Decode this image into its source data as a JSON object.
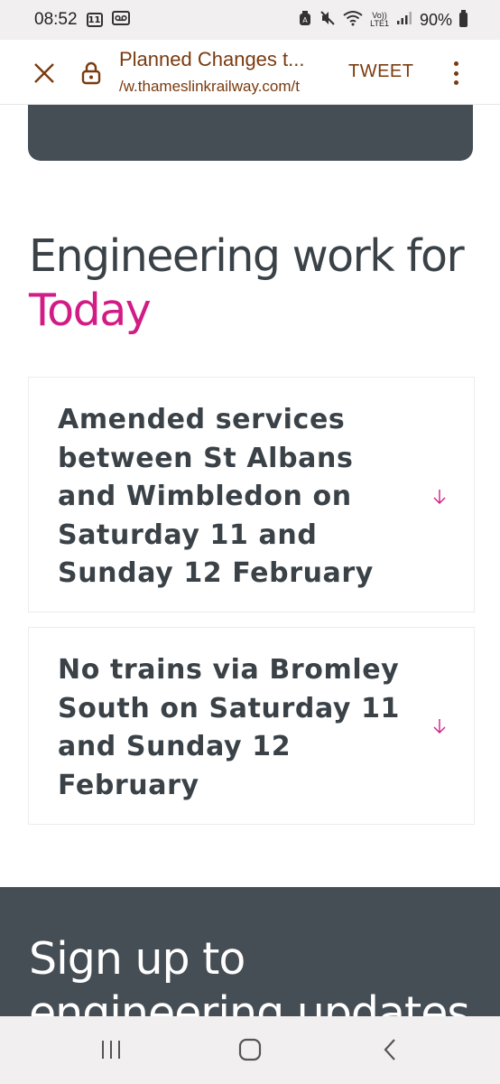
{
  "status_bar": {
    "time": "08:52",
    "notif_calendar": "11",
    "lte_top": "Vo))",
    "lte_bottom": "LTE1",
    "battery": "90%"
  },
  "toolbar": {
    "page_title": "Planned Changes t...",
    "url": "/w.thameslinkrailway.com/t",
    "tweet_label": "TWEET"
  },
  "content": {
    "heading_line1": "Engineering work for",
    "heading_accent": "Today",
    "items": [
      {
        "title": "Amended services between St Albans and Wimbledon on Saturday 11 and Sunday 12 February"
      },
      {
        "title": "No trains via Bromley South on Saturday 11 and Sunday 12 February"
      }
    ],
    "signup_heading": "Sign up to engineering updates"
  },
  "colors": {
    "accent": "#d11c86",
    "dark_panel": "#464e55",
    "text": "#3a4248",
    "toolbar_text": "#7a3a0e"
  }
}
